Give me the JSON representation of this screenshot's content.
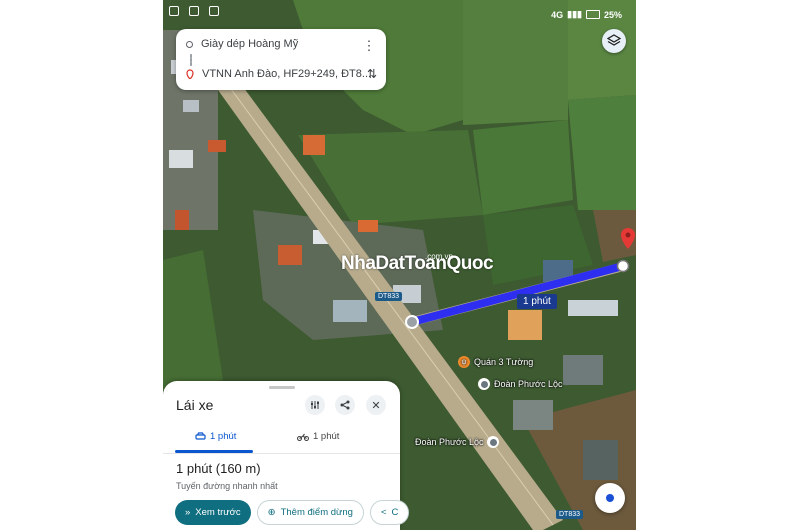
{
  "status_bar": {
    "network": "4G",
    "battery": "25%"
  },
  "route_card": {
    "origin": "Giày dép Hoàng Mỹ",
    "destination": "VTNN Anh Đào, HF29+249, ĐT8..."
  },
  "map": {
    "road_label_1": "DT833",
    "road_label_2": "DT833",
    "eta_label": "1 phút",
    "watermark_main": "NhaDatToanQuoc",
    "watermark_small": ".com.vn",
    "pois": {
      "restaurant": "Quán 3 Tường",
      "place_1": "Đoàn Phước Lộc",
      "place_2": "Đoàn Phước Lộc"
    }
  },
  "sheet": {
    "title": "Lái xe",
    "tabs": [
      {
        "label": "1 phút",
        "icon": "car-icon"
      },
      {
        "label": "1 phút",
        "icon": "motorbike-icon"
      }
    ],
    "duration": "1 phút (160 m)",
    "subtitle": "Tuyến đường nhanh nhất",
    "actions": {
      "preview": "Xem trước",
      "add_stop": "Thêm điểm dừng",
      "share": "C"
    }
  },
  "colors": {
    "route": "#2e2ef0",
    "accent": "#0b57d0",
    "primary_button": "#0f6e7f"
  }
}
